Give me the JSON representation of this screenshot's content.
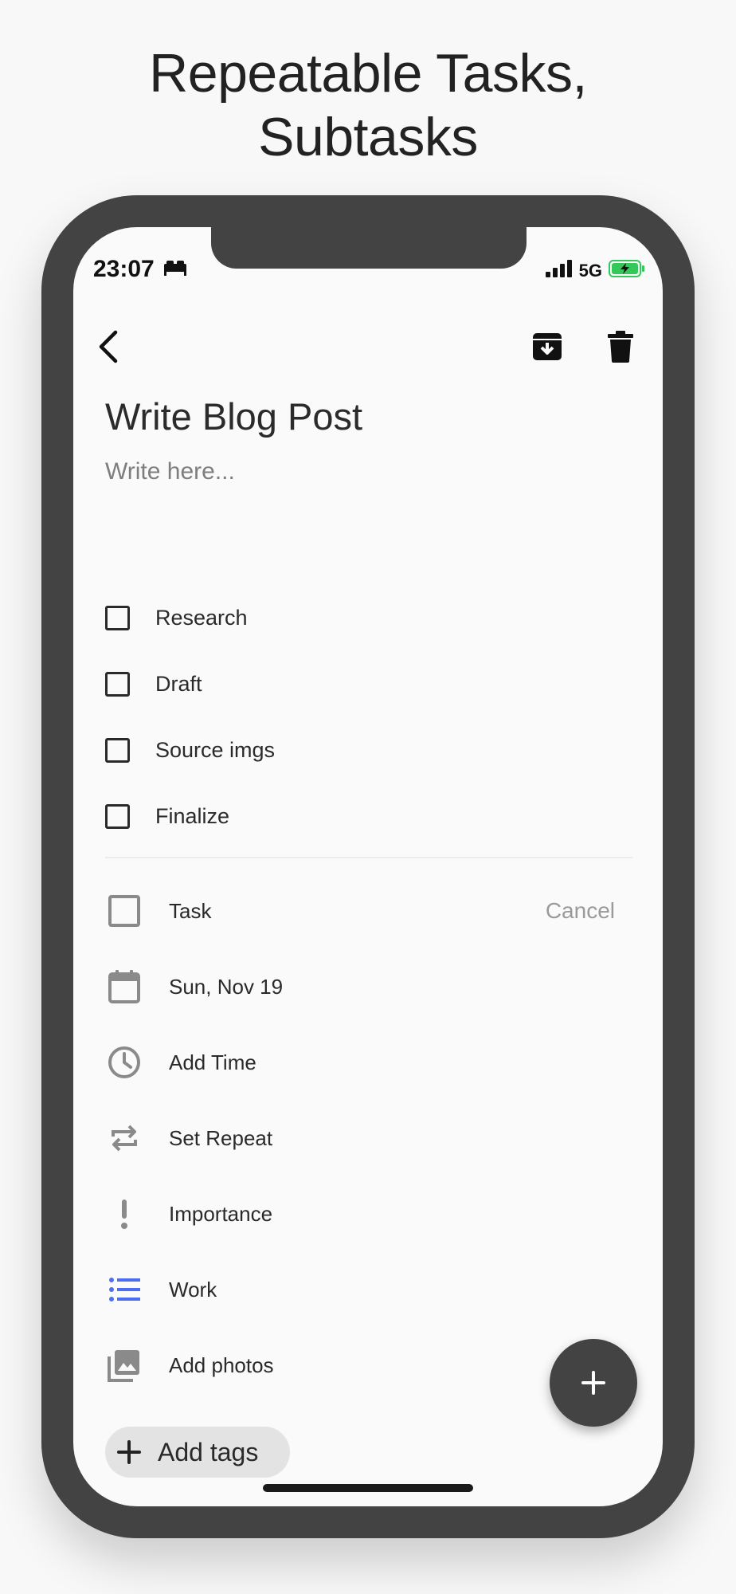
{
  "headline": {
    "line1": "Repeatable Tasks,",
    "line2": "Subtasks"
  },
  "status_bar": {
    "time": "23:07",
    "network": "5G",
    "sleep_icon": "bed-icon",
    "battery_color": "#34c759"
  },
  "task": {
    "title": "Write Blog Post",
    "notes_placeholder": "Write here..."
  },
  "subtasks": [
    {
      "label": "Research",
      "checked": false
    },
    {
      "label": "Draft",
      "checked": false
    },
    {
      "label": "Source imgs",
      "checked": false
    },
    {
      "label": "Finalize",
      "checked": false
    }
  ],
  "details": {
    "type_label": "Task",
    "cancel_label": "Cancel",
    "date_label": "Sun, Nov 19",
    "time_label": "Add Time",
    "repeat_label": "Set Repeat",
    "importance_label": "Importance",
    "list_label": "Work",
    "photos_label": "Add photos",
    "list_color": "#4e6ef2"
  },
  "tags": {
    "add_label": "Add tags"
  }
}
